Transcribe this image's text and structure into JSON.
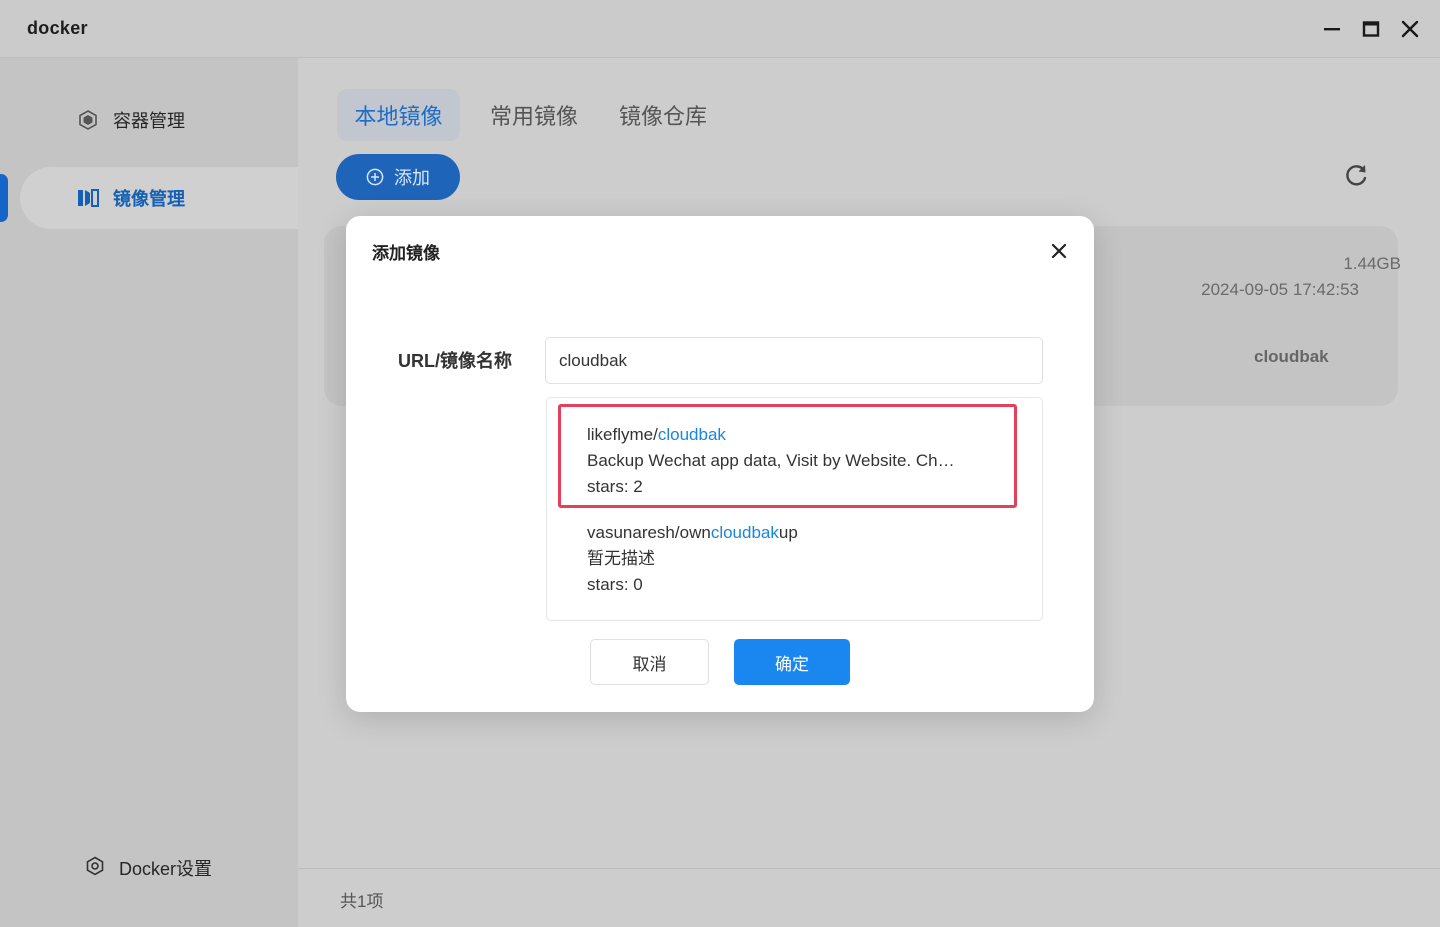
{
  "window": {
    "title": "docker"
  },
  "sidebar": {
    "items": [
      {
        "label": "容器管理",
        "icon": "container-icon"
      },
      {
        "label": "镜像管理",
        "icon": "image-icon",
        "active": true
      }
    ],
    "settings": {
      "label": "Docker设置",
      "icon": "gear-icon"
    }
  },
  "main": {
    "tabs": [
      {
        "label": "本地镜像",
        "active": true
      },
      {
        "label": "常用镜像"
      },
      {
        "label": "镜像仓库"
      }
    ],
    "add_button": {
      "label": "添加"
    },
    "image_card": {
      "size": "1.44GB",
      "created": "2024-09-05 17:42:53",
      "name": "cloudbak"
    },
    "footer": {
      "count_text": "共1项"
    }
  },
  "dialog": {
    "title": "添加镜像",
    "field_label": "URL/镜像名称",
    "input_value": "cloudbak",
    "suggestions": [
      {
        "name_prefix": "likeflyme/",
        "name_match": "cloudbak",
        "name_suffix": "",
        "description": "Backup Wechat app data, Visit by Website. Ch…",
        "stars": "stars: 2"
      },
      {
        "name_prefix": "vasunaresh/own",
        "name_match": "cloudbak",
        "name_suffix": "up",
        "description": "暂无描述",
        "stars": "stars: 0"
      }
    ],
    "cancel_label": "取消",
    "confirm_label": "确定"
  },
  "colors": {
    "accent": "#1a86f0",
    "highlight_border": "#e5405a",
    "match_text": "#1a85e0"
  }
}
